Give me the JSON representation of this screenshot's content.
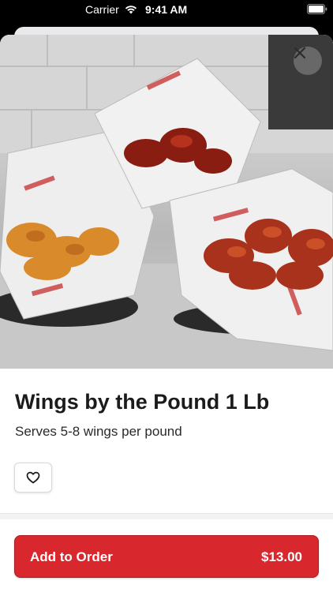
{
  "status_bar": {
    "carrier": "Carrier",
    "time": "9:41 AM"
  },
  "hero": {
    "image_alt": "Wings by the Pound",
    "close_icon": "close-icon"
  },
  "item": {
    "title": "Wings by the Pound 1 Lb",
    "description": "Serves 5-8 wings per pound",
    "favorite_icon": "heart-icon"
  },
  "order_button": {
    "label": "Add to Order",
    "price": "$13.00",
    "color": "#d8282d"
  }
}
